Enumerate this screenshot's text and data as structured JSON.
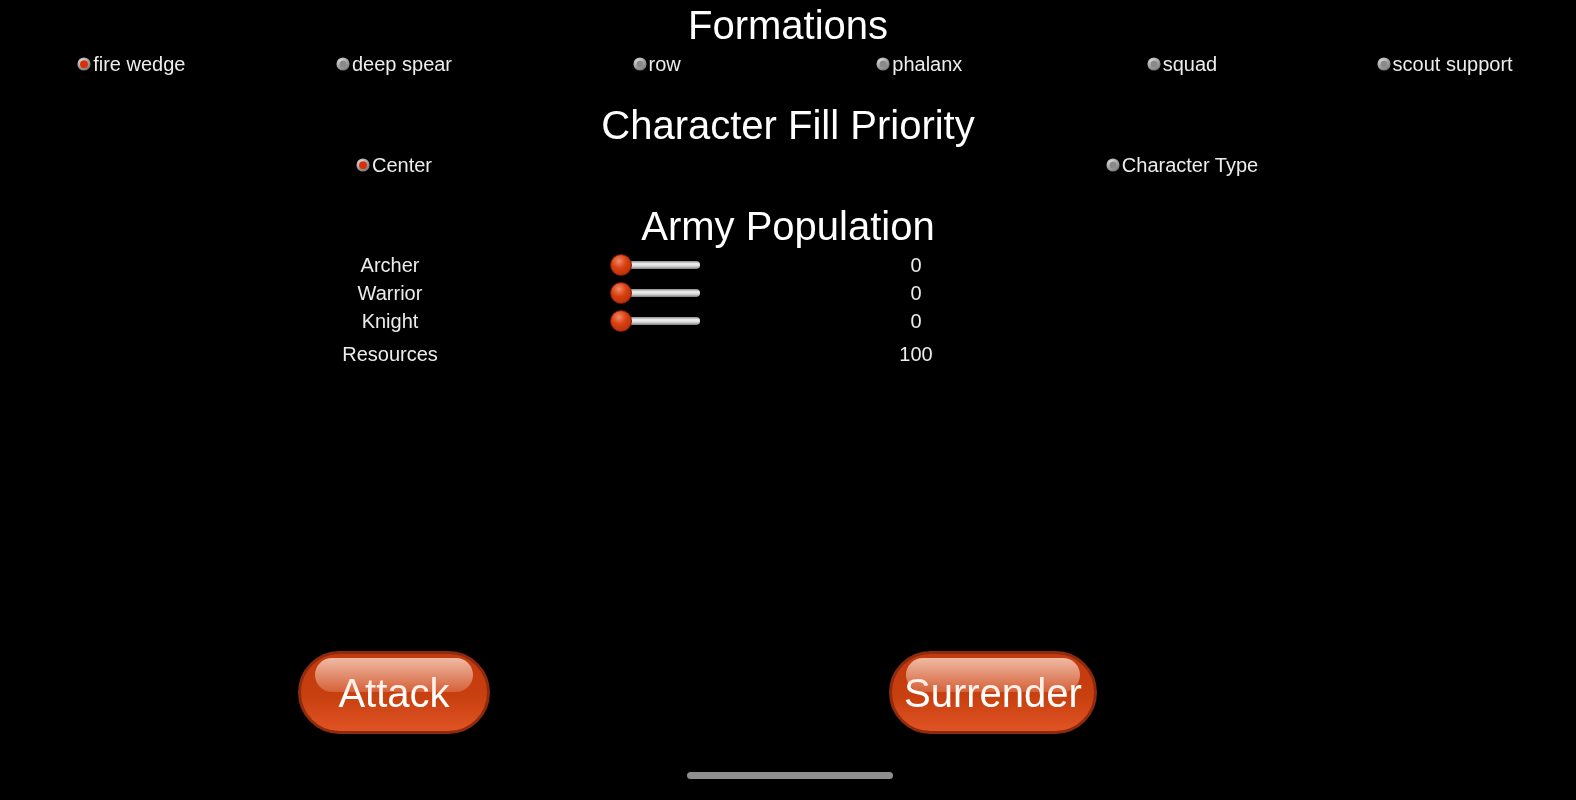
{
  "formations": {
    "title": "Formations",
    "options": [
      {
        "label": "fire wedge",
        "selected": true
      },
      {
        "label": "deep spear",
        "selected": false
      },
      {
        "label": "row",
        "selected": false
      },
      {
        "label": "phalanx",
        "selected": false
      },
      {
        "label": "squad",
        "selected": false
      },
      {
        "label": "scout support",
        "selected": false
      }
    ]
  },
  "fill_priority": {
    "title": "Character Fill Priority",
    "options": [
      {
        "label": "Center",
        "selected": true
      },
      {
        "label": "Character Type",
        "selected": false
      }
    ]
  },
  "army_population": {
    "title": "Army Population",
    "units": [
      {
        "name": "Archer",
        "level": 0,
        "value": "0"
      },
      {
        "name": "Warrior",
        "level": 0,
        "value": "0"
      },
      {
        "name": "Knight",
        "level": 0,
        "value": "0"
      }
    ],
    "resources": {
      "label": "Resources",
      "value": "100"
    }
  },
  "buttons": [
    "Attack",
    "Surrender"
  ]
}
